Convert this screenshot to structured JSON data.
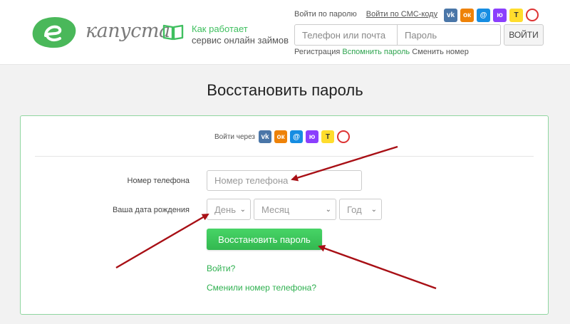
{
  "header": {
    "logo_text": "капуста",
    "how_line1": "Как работает",
    "how_line2": "сервис онлайн займов",
    "tab_password": "Войти по паролю",
    "tab_sms": "Войти по СМС-коду",
    "phone_placeholder": "Телефон или почта",
    "password_placeholder": "Пароль",
    "login_button": "ВОЙТИ",
    "link_register": "Регистрация",
    "link_remind": "Вспомнить пароль",
    "link_change": "Сменить номер",
    "social": [
      {
        "name": "vk-icon",
        "glyph": "vk"
      },
      {
        "name": "odnoklassniki-icon",
        "glyph": "ок"
      },
      {
        "name": "mail-ru-icon",
        "glyph": "@"
      },
      {
        "name": "yumoney-icon",
        "glyph": "ю"
      },
      {
        "name": "tinkoff-icon",
        "glyph": "T"
      },
      {
        "name": "gosuslugi-icon",
        "glyph": ""
      }
    ]
  },
  "main": {
    "title": "Восстановить пароль",
    "via_label": "Войти через",
    "phone_label": "Номер телефона",
    "phone_placeholder": "Номер телефона",
    "dob_label": "Ваша дата рождения",
    "day_placeholder": "День",
    "month_placeholder": "Месяц",
    "year_placeholder": "Год",
    "restore_button": "Восстановить пароль",
    "link_enter": "Войти?",
    "link_changed_phone": "Сменили номер телефона?"
  },
  "colors": {
    "brand_green": "#3fbf5f",
    "arrow_red": "#a80f15"
  }
}
